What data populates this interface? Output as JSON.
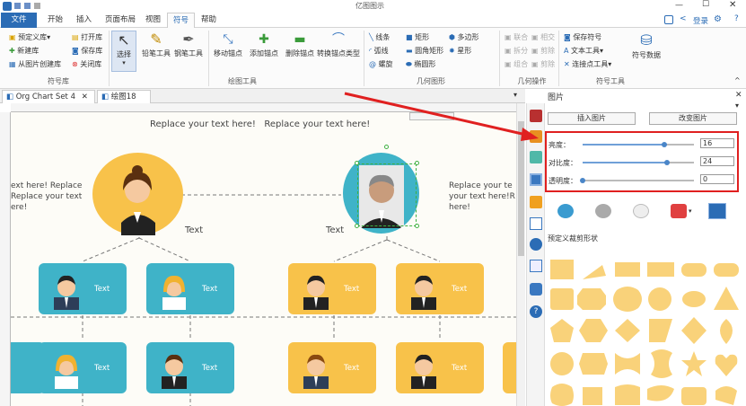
{
  "app": {
    "title": "亿图图示"
  },
  "titlebar": {
    "login": "登录"
  },
  "menu": [
    "文件",
    "开始",
    "插入",
    "页面布局",
    "视图",
    "符号",
    "帮助"
  ],
  "ribbon": {
    "symbol_lib": {
      "items": [
        "预定义库",
        "打开库",
        "新建库",
        "保存库",
        "从图片创建库",
        "关闭库"
      ],
      "label": "符号库"
    },
    "draw_tools": {
      "items": [
        "选择",
        "铅笔工具",
        "钢笔工具",
        "移动锚点",
        "添加锚点",
        "删除锚点",
        "转换锚点类型"
      ],
      "label": "绘图工具"
    },
    "geometry": {
      "items": [
        "线条",
        "矩形",
        "多边形",
        "弧线",
        "圆角矩形",
        "星形",
        "螺旋",
        "椭圆形"
      ],
      "label": "几何图形"
    },
    "geo_ops": {
      "items": [
        "联合",
        "相交",
        "拆分",
        "剪除",
        "组合",
        "剪除"
      ],
      "label": "几何操作"
    },
    "symbol_ops": {
      "items": [
        "保存符号",
        "文本工具",
        "连接点工具",
        "符号数据"
      ],
      "label": "符号工具"
    }
  },
  "doctabs": [
    "Org Chart Set 4",
    "绘图18"
  ],
  "canvas": {
    "header_text": "Replace your text here!   Replace your text here!",
    "left_text": "ext here! Replace\nReplace your text\nere!",
    "right_text": "Replace your te\nyour text here!R\nhere!",
    "label_left": "Text",
    "label_right": "Text",
    "card_text": "Text"
  },
  "panel": {
    "title": "图片",
    "insert_btn": "插入图片",
    "change_btn": "改变图片",
    "brightness": {
      "label": "亮度：",
      "value": "16",
      "fraction": 0.73
    },
    "contrast": {
      "label": "对比度：",
      "value": "24",
      "fraction": 0.76
    },
    "transparency": {
      "label": "透明度：",
      "value": "0",
      "fraction": 0.0
    },
    "shapes_title": "预定义裁剪形状"
  },
  "colors": {
    "accent": "#2b6cb5",
    "teal": "#3fb3c8",
    "yellow": "#f8c24a",
    "shape": "#f9d27a",
    "highlight": "#e02020"
  }
}
